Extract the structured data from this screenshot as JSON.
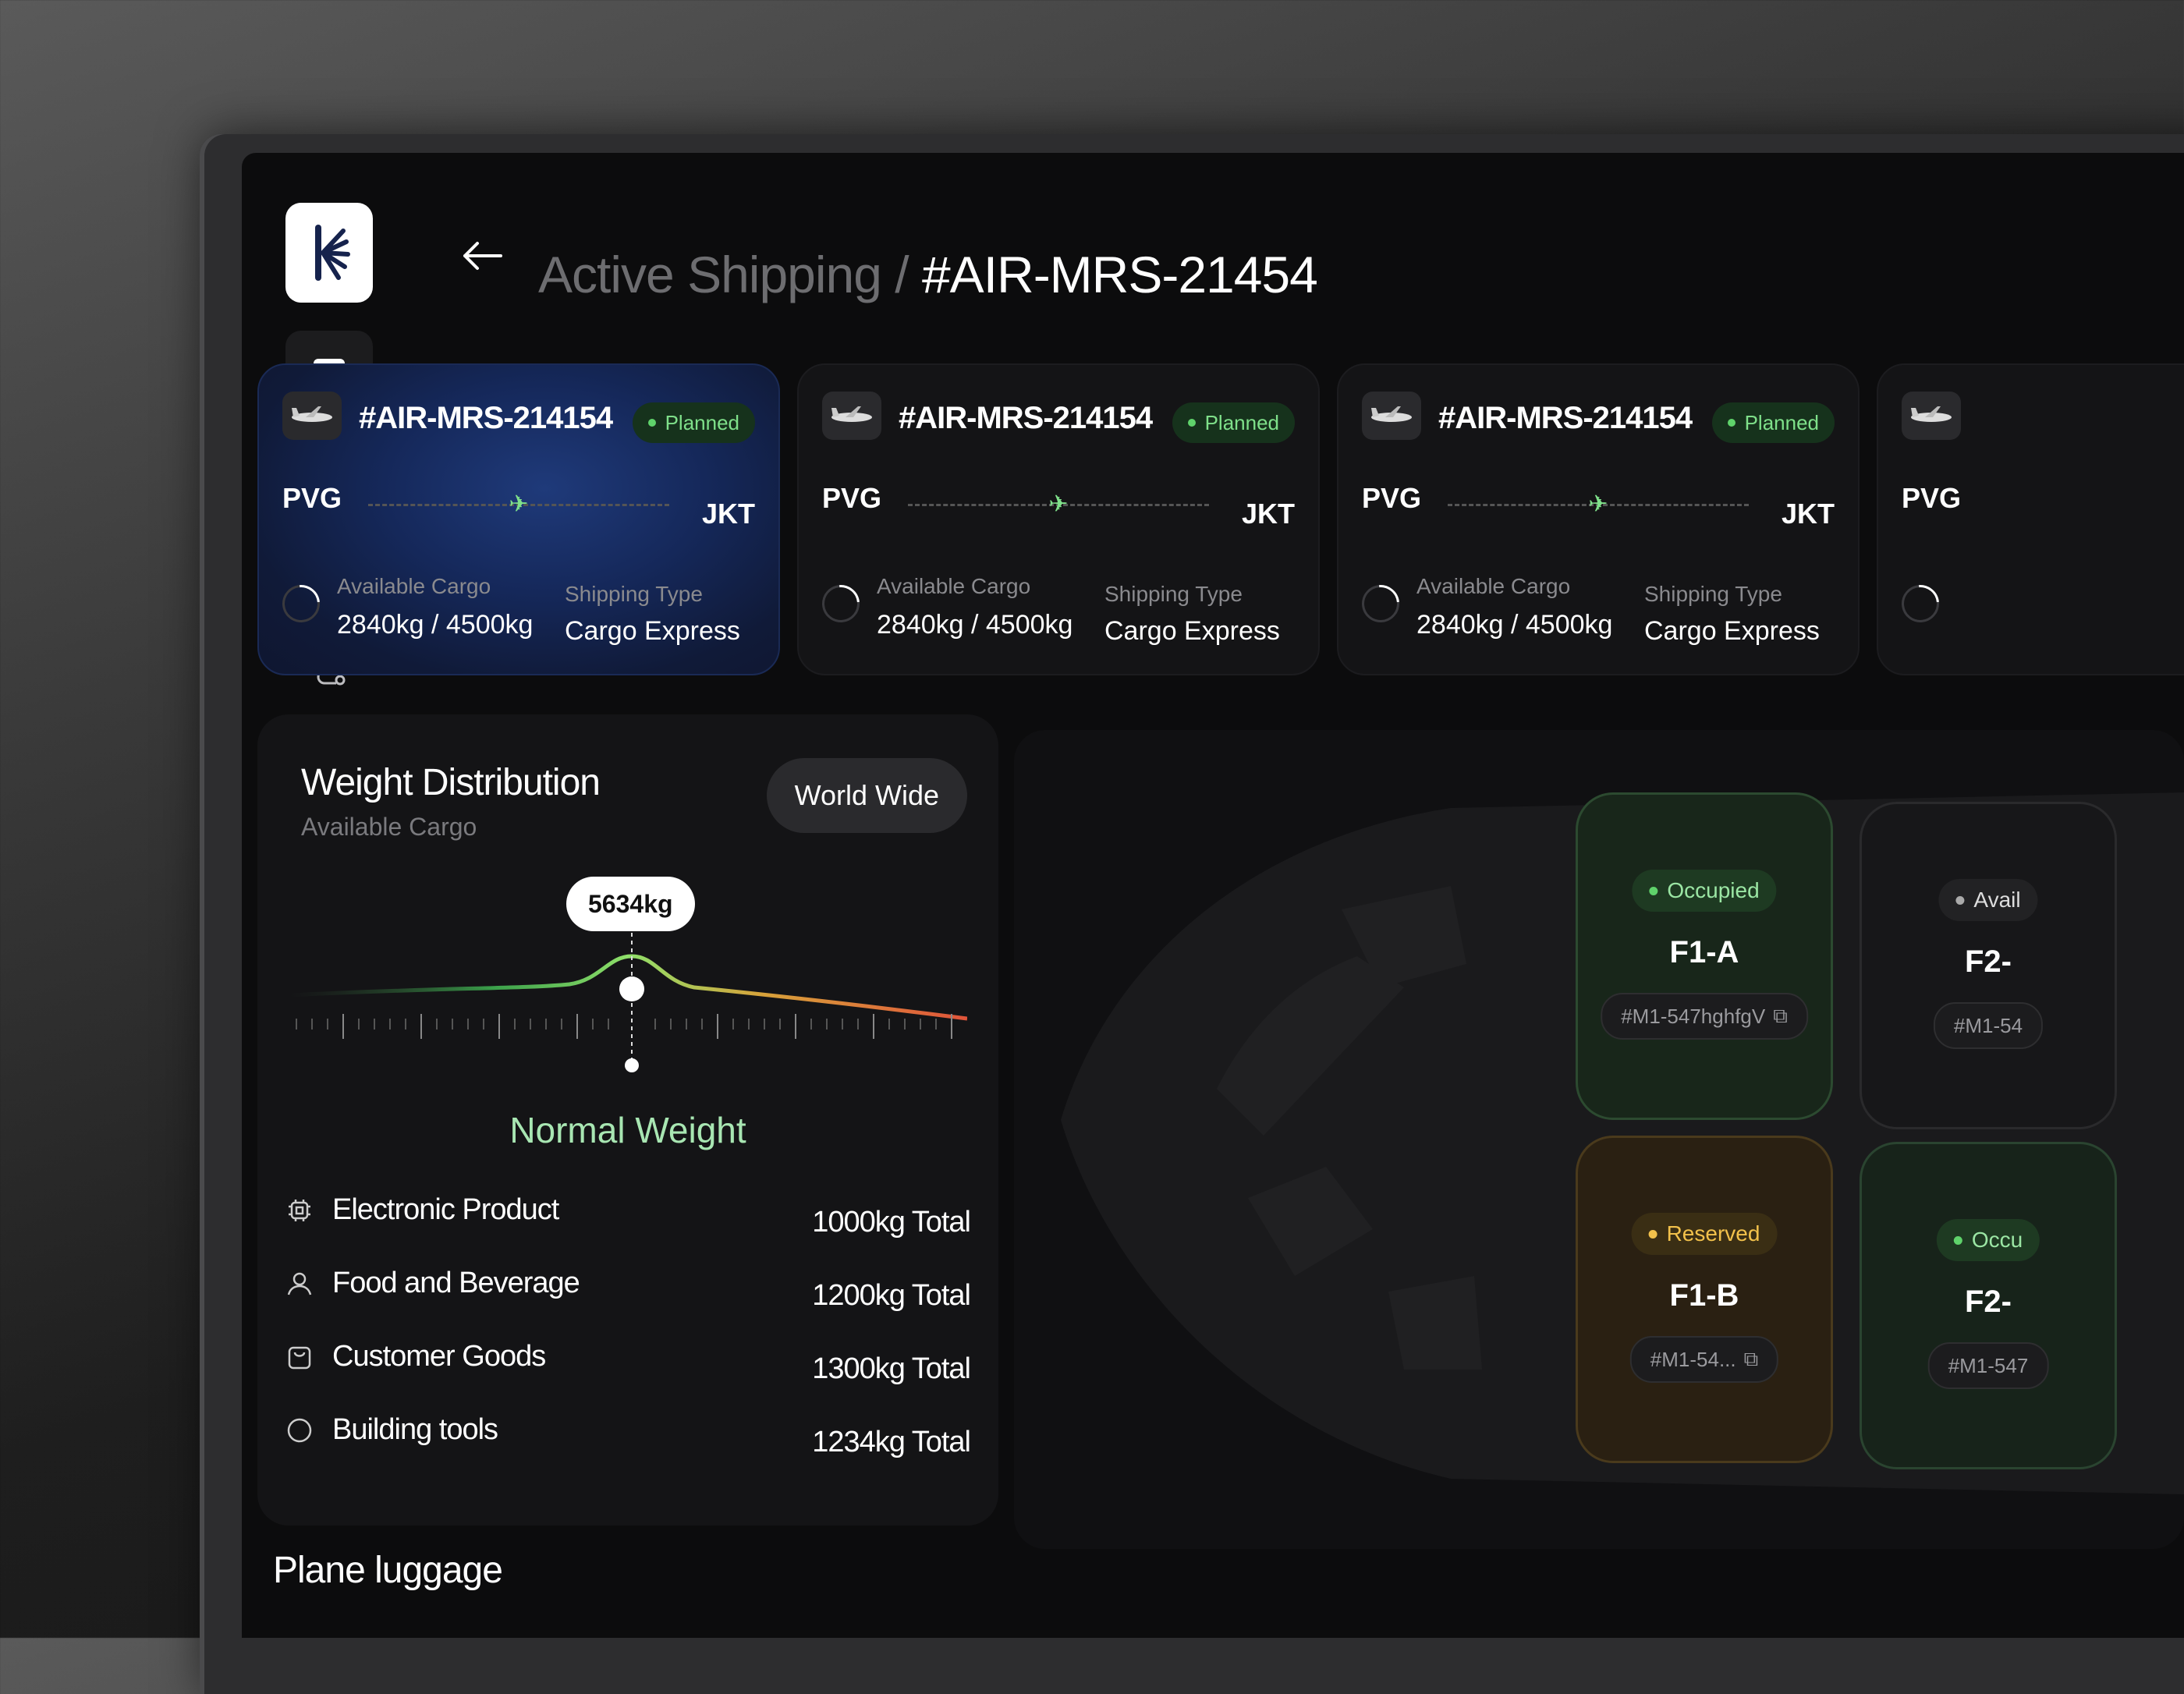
{
  "header": {
    "section": "Active Shipping /",
    "shipment_id": "#AIR-MRS-21454"
  },
  "cards": [
    {
      "code": "#AIR-MRS-214154",
      "status": "Planned",
      "from": "PVG",
      "to": "JKT",
      "cargo_label": "Available Cargo",
      "cargo_value": "2840kg / 4500kg",
      "type_label": "Shipping Type",
      "type_value": "Cargo Express"
    },
    {
      "code": "#AIR-MRS-214154",
      "status": "Planned",
      "from": "PVG",
      "to": "JKT",
      "cargo_label": "Available Cargo",
      "cargo_value": "2840kg / 4500kg",
      "type_label": "Shipping Type",
      "type_value": "Cargo Express"
    },
    {
      "code": "#AIR-MRS-214154",
      "status": "Planned",
      "from": "PVG",
      "to": "JKT",
      "cargo_label": "Available Cargo",
      "cargo_value": "2840kg / 4500kg",
      "type_label": "Shipping Type",
      "type_value": "Cargo Express"
    },
    {
      "from": "PVG"
    }
  ],
  "weight": {
    "title": "Weight Distribution",
    "subtitle": "Available Cargo",
    "filter": "World Wide",
    "tooltip": "5634kg",
    "status": "Normal Weight",
    "items": [
      {
        "name": "Electronic Product",
        "total": "1000kg Total",
        "icon": "chip-icon"
      },
      {
        "name": "Food and Beverage",
        "total": "1200kg Total",
        "icon": "user-icon"
      },
      {
        "name": "Customer Goods",
        "total": "1300kg Total",
        "icon": "bag-icon"
      },
      {
        "name": "Building tools",
        "total": "1234kg Total",
        "icon": "circle-icon"
      }
    ]
  },
  "luggage_title": "Plane luggage",
  "seats": [
    {
      "status": "Occupied",
      "id": "F1-A",
      "code": "#M1-547hghfgV",
      "color": "#7fe08a"
    },
    {
      "status": "Reserved",
      "id": "F1-B",
      "code": "#M1-54...",
      "color": "#f2c14b"
    },
    {
      "status": "Avail",
      "id": "F2-",
      "code": "#M1-54",
      "color": "#bbbbbb"
    },
    {
      "status": "Occu",
      "id": "F2-",
      "code": "#M1-547",
      "color": "#7fe08a"
    }
  ],
  "colors": {
    "accent_green": "#5fd36b",
    "reserved": "#f2c14b",
    "card_active": "#15285a"
  }
}
